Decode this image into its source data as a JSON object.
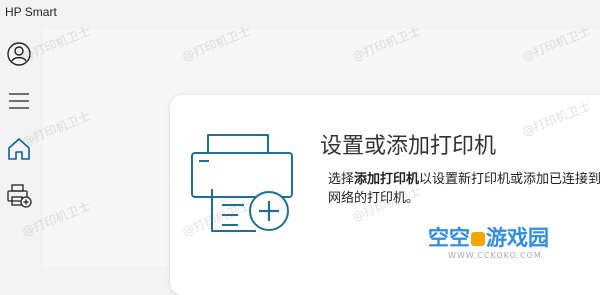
{
  "app": {
    "title": "HP Smart"
  },
  "rail": {
    "items": [
      {
        "name": "account",
        "icon": "account-circle-icon"
      },
      {
        "name": "menu",
        "icon": "hamburger-menu-icon"
      },
      {
        "name": "home",
        "icon": "home-icon"
      },
      {
        "name": "add-printer",
        "icon": "printer-add-icon"
      }
    ]
  },
  "setup_card": {
    "title": "设置或添加打印机",
    "desc_pre": "选择",
    "desc_bold": "添加打印机",
    "desc_post": "以设置新打印机或添加已连接到网络的打印机。",
    "illustration_icon": "printer-add-illustration"
  },
  "watermark": {
    "text": "@打印机卫士"
  },
  "brand_watermark": {
    "text_a": "空空",
    "text_b": "游戏园",
    "url": "WWW.CCKOKO.COM"
  },
  "colors": {
    "accent": "#0b5fa5",
    "icon_stroke": "#1f6f99",
    "brand": "#2f8de4"
  }
}
